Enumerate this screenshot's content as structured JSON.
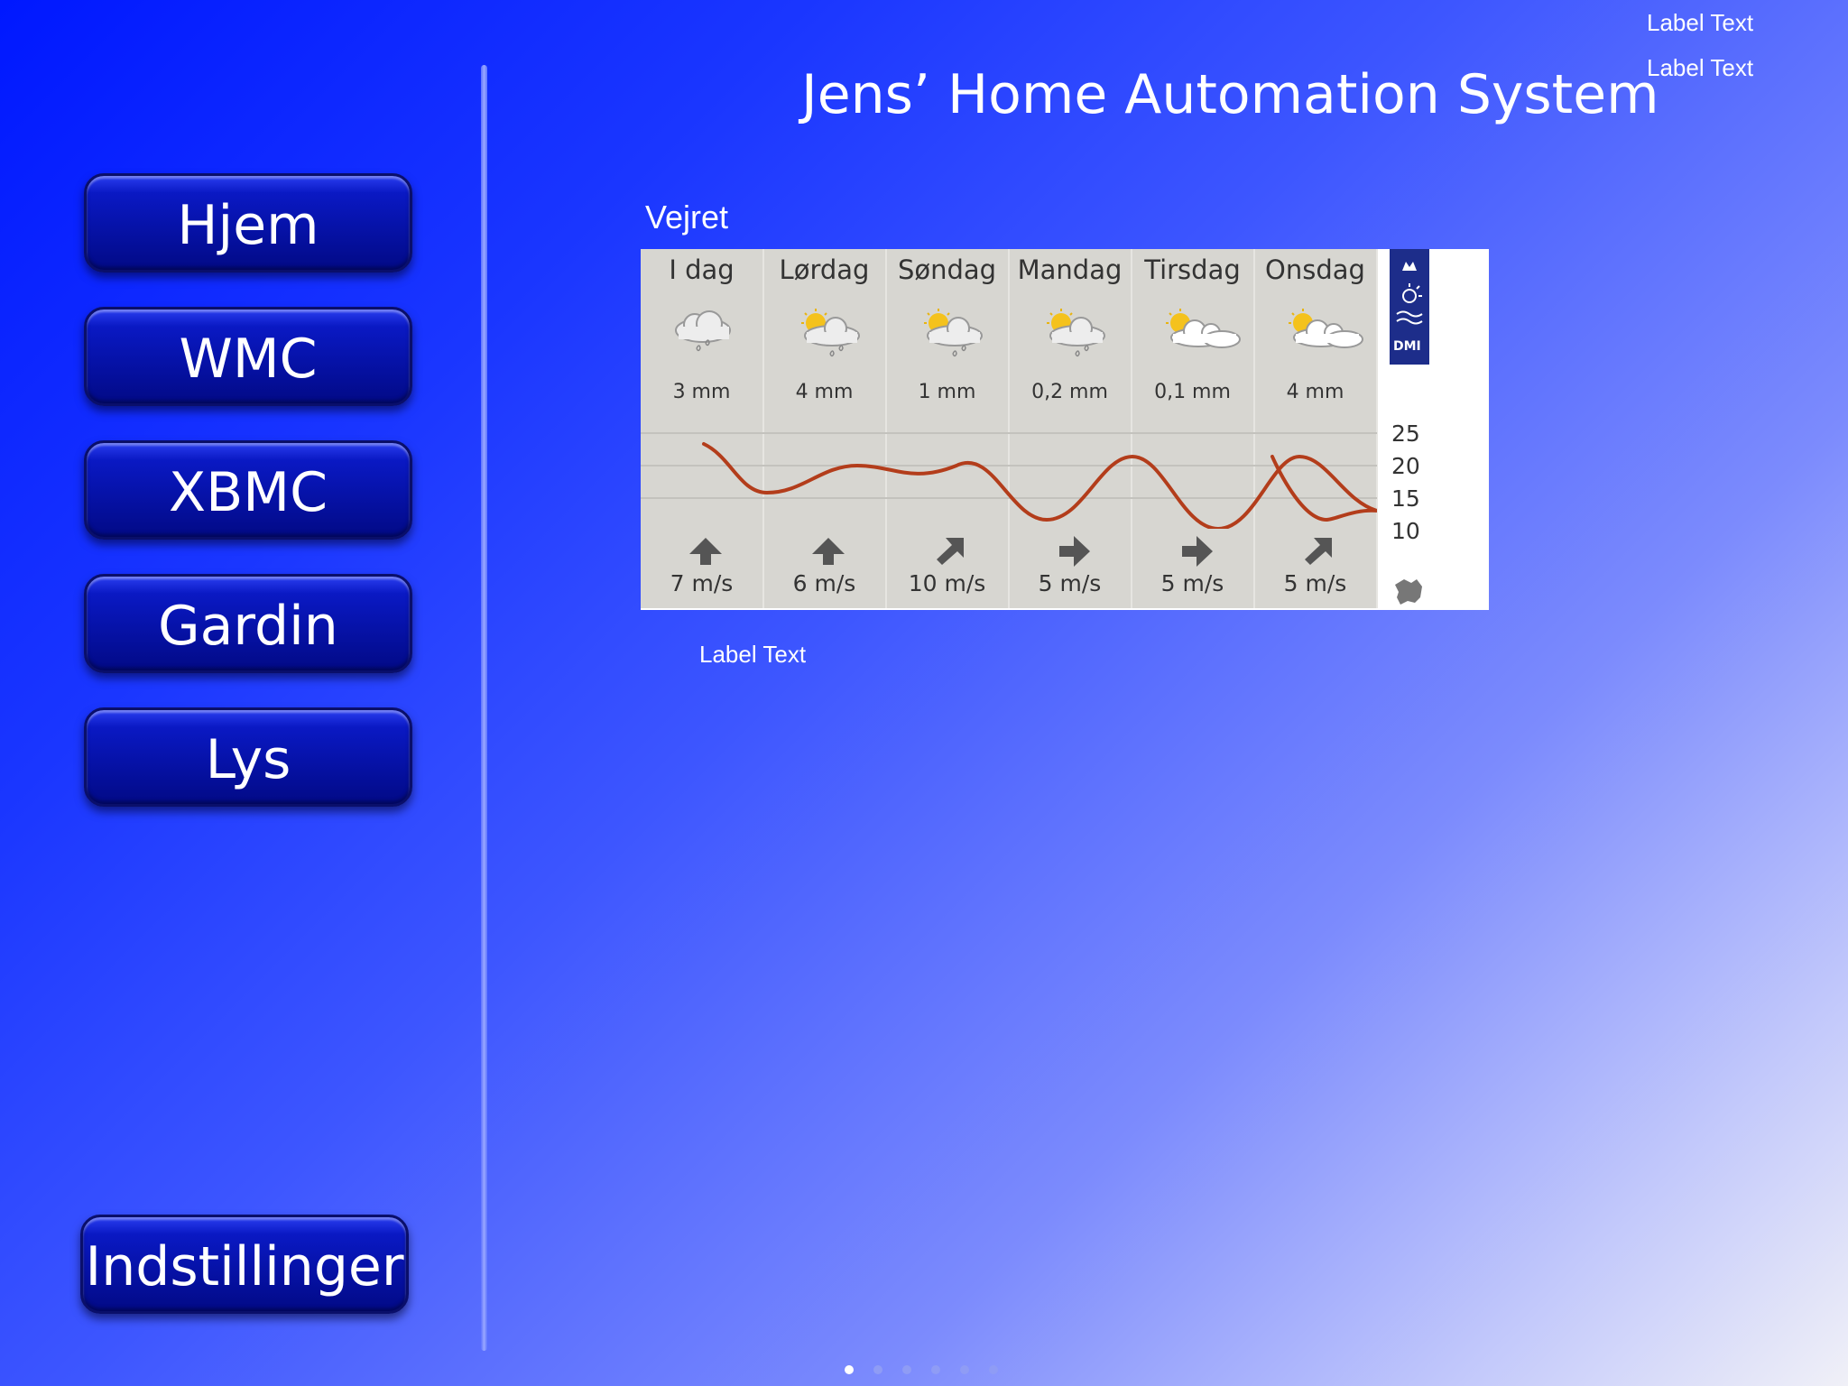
{
  "title": "Jens’ Home Automation System",
  "top_labels": [
    "Label Text",
    "Label Text"
  ],
  "nav": {
    "items": [
      {
        "label": "Hjem"
      },
      {
        "label": "WMC"
      },
      {
        "label": "XBMC"
      },
      {
        "label": "Gardin"
      },
      {
        "label": "Lys"
      }
    ],
    "settings": "Indstillinger"
  },
  "weather": {
    "section_label": "Vejret",
    "provider": "DMI",
    "days": [
      {
        "name": "I dag",
        "rain": "3 mm",
        "wind": "7 m/s",
        "icon": "rain-cloud-icon",
        "wind_dir": "north"
      },
      {
        "name": "Lørdag",
        "rain": "4 mm",
        "wind": "6 m/s",
        "icon": "sun-rain-cloud-icon",
        "wind_dir": "north"
      },
      {
        "name": "Søndag",
        "rain": "1 mm",
        "wind": "10 m/s",
        "icon": "sun-rain-cloud-icon",
        "wind_dir": "northeast"
      },
      {
        "name": "Mandag",
        "rain": "0,2 mm",
        "wind": "5 m/s",
        "icon": "sun-rain-cloud-icon",
        "wind_dir": "east"
      },
      {
        "name": "Tirsdag",
        "rain": "0,1 mm",
        "wind": "5 m/s",
        "icon": "sun-cloud-icon",
        "wind_dir": "east"
      },
      {
        "name": "Onsdag",
        "rain": "4 mm",
        "wind": "5 m/s",
        "icon": "sun-cloud-icon",
        "wind_dir": "northeast"
      }
    ],
    "temp_ticks": [
      "25",
      "20",
      "15",
      "10"
    ],
    "line_color": "#b33d1b"
  },
  "bottom_label": "Label Text",
  "page_indicator": {
    "count": 6,
    "active": 0
  }
}
